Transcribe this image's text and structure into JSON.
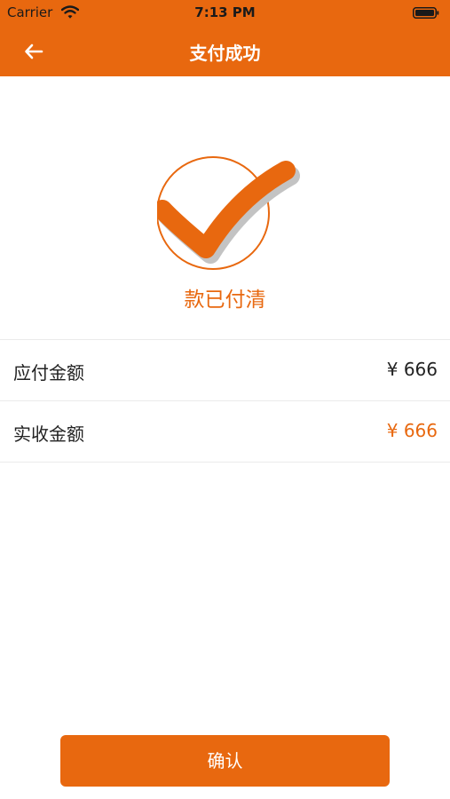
{
  "status_bar": {
    "carrier": "Carrier",
    "time": "7:13 PM"
  },
  "header": {
    "title": "支付成功",
    "back_icon": "arrow-left-icon"
  },
  "status": {
    "icon": "check-circle-icon",
    "text": "款已付清"
  },
  "amounts": [
    {
      "label": "应付金额",
      "value": "¥ 666"
    },
    {
      "label": "实收金额",
      "value": "¥ 666"
    }
  ],
  "confirm_label": "确认",
  "colors": {
    "accent": "#e8680f",
    "text": "#222222",
    "background": "#ffffff",
    "divider": "#ebebeb"
  }
}
